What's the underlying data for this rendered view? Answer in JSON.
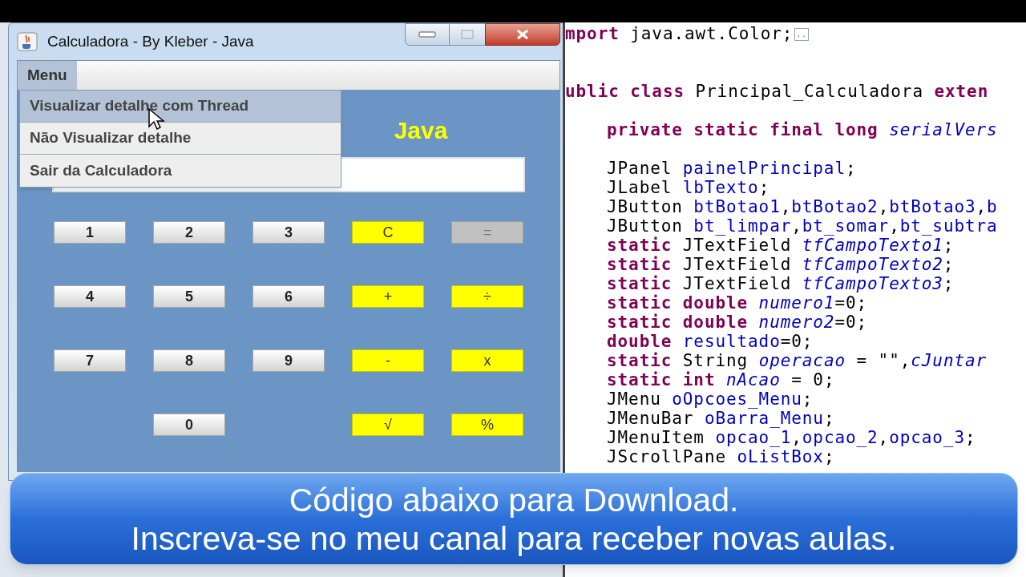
{
  "window": {
    "title": "Calculadora - By Kleber - Java"
  },
  "menu_bar": {
    "menus": [
      {
        "label": "Menu",
        "selected": true
      }
    ]
  },
  "menu_dropdown": {
    "items": [
      {
        "label": "Visualizar detalhe com Thread",
        "selected": true
      },
      {
        "label": "Não Visualizar detalhe",
        "selected": false
      },
      {
        "label": "Sair da Calculadora",
        "selected": false
      }
    ]
  },
  "calculator": {
    "heading": "Java",
    "rows": [
      [
        {
          "label": "1",
          "kind": "number"
        },
        {
          "label": "2",
          "kind": "number"
        },
        {
          "label": "3",
          "kind": "number"
        },
        {
          "label": "C",
          "kind": "operator"
        },
        {
          "label": "=",
          "kind": "disabled"
        }
      ],
      [
        {
          "label": "4",
          "kind": "number"
        },
        {
          "label": "5",
          "kind": "number"
        },
        {
          "label": "6",
          "kind": "number"
        },
        {
          "label": "+",
          "kind": "operator"
        },
        {
          "label": "÷",
          "kind": "operator"
        }
      ],
      [
        {
          "label": "7",
          "kind": "number"
        },
        {
          "label": "8",
          "kind": "number"
        },
        {
          "label": "9",
          "kind": "number"
        },
        {
          "label": "-",
          "kind": "operator"
        },
        {
          "label": "x",
          "kind": "operator"
        }
      ],
      [
        {
          "kind": "empty"
        },
        {
          "label": "0",
          "kind": "number"
        },
        {
          "kind": "empty"
        },
        {
          "label": "√",
          "kind": "operator"
        },
        {
          "label": "%",
          "kind": "operator"
        }
      ]
    ]
  },
  "code_editor": {
    "lines": [
      {
        "kind": "code",
        "indented": false,
        "tokens": [
          {
            "kind": "keyword",
            "text": "mport"
          },
          {
            "kind": "plain",
            "text": " java.awt.Color;"
          },
          {
            "kind": "fold",
            "text": ".."
          }
        ]
      },
      {
        "kind": "blank"
      },
      {
        "kind": "blank"
      },
      {
        "kind": "code",
        "indented": false,
        "tokens": [
          {
            "kind": "keyword",
            "text": "ublic class"
          },
          {
            "kind": "plain",
            "text": " Principal_Calculadora "
          },
          {
            "kind": "keyword",
            "text": "exten"
          }
        ]
      },
      {
        "kind": "blank"
      },
      {
        "kind": "code",
        "indented": true,
        "tokens": [
          {
            "kind": "keyword",
            "text": "private static final long "
          },
          {
            "kind": "static_field",
            "text": "serialVers"
          }
        ]
      },
      {
        "kind": "blank"
      },
      {
        "kind": "code",
        "indented": true,
        "tokens": [
          {
            "kind": "plain",
            "text": "JPanel "
          },
          {
            "kind": "field",
            "text": "painelPrincipal"
          },
          {
            "kind": "plain",
            "text": ";"
          }
        ]
      },
      {
        "kind": "code",
        "indented": true,
        "tokens": [
          {
            "kind": "plain",
            "text": "JLabel "
          },
          {
            "kind": "field",
            "text": "lbTexto"
          },
          {
            "kind": "plain",
            "text": ";"
          }
        ]
      },
      {
        "kind": "code",
        "indented": true,
        "tokens": [
          {
            "kind": "plain",
            "text": "JButton "
          },
          {
            "kind": "field",
            "text": "btBotao1"
          },
          {
            "kind": "plain",
            "text": ","
          },
          {
            "kind": "field",
            "text": "btBotao2"
          },
          {
            "kind": "plain",
            "text": ","
          },
          {
            "kind": "field",
            "text": "btBotao3"
          },
          {
            "kind": "plain",
            "text": ","
          },
          {
            "kind": "field",
            "text": "b"
          }
        ]
      },
      {
        "kind": "code",
        "indented": true,
        "tokens": [
          {
            "kind": "plain",
            "text": "JButton "
          },
          {
            "kind": "field",
            "text": "bt_limpar"
          },
          {
            "kind": "plain",
            "text": ","
          },
          {
            "kind": "field",
            "text": "bt_somar"
          },
          {
            "kind": "plain",
            "text": ","
          },
          {
            "kind": "field",
            "text": "bt_subtra"
          }
        ]
      },
      {
        "kind": "code",
        "indented": true,
        "tokens": [
          {
            "kind": "keyword",
            "text": "static"
          },
          {
            "kind": "plain",
            "text": " JTextField "
          },
          {
            "kind": "static_field",
            "text": "tfCampoTexto1"
          },
          {
            "kind": "plain",
            "text": ";"
          }
        ]
      },
      {
        "kind": "code",
        "indented": true,
        "tokens": [
          {
            "kind": "keyword",
            "text": "static"
          },
          {
            "kind": "plain",
            "text": " JTextField "
          },
          {
            "kind": "static_field",
            "text": "tfCampoTexto2"
          },
          {
            "kind": "plain",
            "text": ";"
          }
        ]
      },
      {
        "kind": "code",
        "indented": true,
        "tokens": [
          {
            "kind": "keyword",
            "text": "static"
          },
          {
            "kind": "plain",
            "text": " JTextField "
          },
          {
            "kind": "static_field",
            "text": "tfCampoTexto3"
          },
          {
            "kind": "plain",
            "text": ";"
          }
        ]
      },
      {
        "kind": "code",
        "indented": true,
        "tokens": [
          {
            "kind": "keyword",
            "text": "static double "
          },
          {
            "kind": "static_field",
            "text": "numero1"
          },
          {
            "kind": "plain",
            "text": "=0;"
          }
        ]
      },
      {
        "kind": "code",
        "indented": true,
        "tokens": [
          {
            "kind": "keyword",
            "text": "static double "
          },
          {
            "kind": "static_field",
            "text": "numero2"
          },
          {
            "kind": "plain",
            "text": "=0;"
          }
        ]
      },
      {
        "kind": "code",
        "indented": true,
        "tokens": [
          {
            "kind": "keyword",
            "text": "double "
          },
          {
            "kind": "field",
            "text": "resultado"
          },
          {
            "kind": "plain",
            "text": "=0;"
          }
        ]
      },
      {
        "kind": "code",
        "indented": true,
        "tokens": [
          {
            "kind": "keyword",
            "text": "static"
          },
          {
            "kind": "plain",
            "text": " String "
          },
          {
            "kind": "static_field",
            "text": "operacao"
          },
          {
            "kind": "plain",
            "text": " = \"\","
          },
          {
            "kind": "static_field",
            "text": "cJuntar"
          }
        ]
      },
      {
        "kind": "code",
        "indented": true,
        "tokens": [
          {
            "kind": "keyword",
            "text": "static int "
          },
          {
            "kind": "static_field",
            "text": "nAcao"
          },
          {
            "kind": "plain",
            "text": " = 0;"
          }
        ]
      },
      {
        "kind": "code",
        "indented": true,
        "tokens": [
          {
            "kind": "plain",
            "text": "JMenu "
          },
          {
            "kind": "field",
            "text": "oOpcoes_Menu"
          },
          {
            "kind": "plain",
            "text": ";"
          }
        ]
      },
      {
        "kind": "code",
        "indented": true,
        "tokens": [
          {
            "kind": "plain",
            "text": "JMenuBar "
          },
          {
            "kind": "field",
            "text": "oBarra_Menu"
          },
          {
            "kind": "plain",
            "text": ";"
          }
        ]
      },
      {
        "kind": "code",
        "indented": true,
        "tokens": [
          {
            "kind": "plain",
            "text": "JMenuItem "
          },
          {
            "kind": "field",
            "text": "opcao_1"
          },
          {
            "kind": "plain",
            "text": ","
          },
          {
            "kind": "field",
            "text": "opcao_2"
          },
          {
            "kind": "plain",
            "text": ","
          },
          {
            "kind": "field",
            "text": "opcao_3"
          },
          {
            "kind": "plain",
            "text": ";"
          }
        ]
      },
      {
        "kind": "code",
        "indented": true,
        "tokens": [
          {
            "kind": "plain",
            "text": "JScrollPane "
          },
          {
            "kind": "field",
            "text": "oListBox"
          },
          {
            "kind": "plain",
            "text": ";"
          }
        ]
      }
    ]
  },
  "caption": {
    "lines": [
      "Código abaixo para Download.",
      "Inscreva-se no meu canal para receber novas aulas."
    ]
  }
}
